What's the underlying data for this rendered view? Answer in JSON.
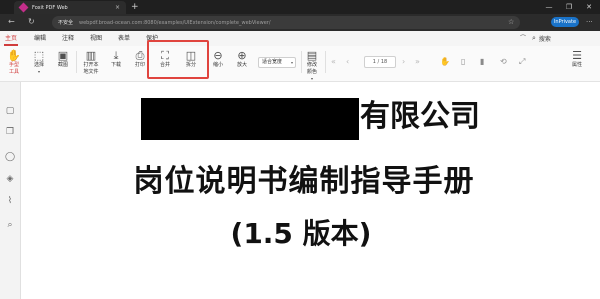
{
  "browser": {
    "tab_title": "Foxit PDF Web",
    "tab_close": "×",
    "new_tab": "+",
    "window_controls": {
      "minimize": "—",
      "maximize": "❐",
      "close": "✕"
    },
    "nav": {
      "back": "←",
      "reload": "↻"
    },
    "security_label": "不安全",
    "url": "webpdf.broad-ocean.com:8080/examples/UIExtension/complete_webViewer/",
    "favorite_icon": "star-icon",
    "inprivate_label": "InPrivate",
    "more": "···"
  },
  "menu": {
    "items": [
      {
        "label": "主页",
        "active": true
      },
      {
        "label": "编辑"
      },
      {
        "label": "注释"
      },
      {
        "label": "视图"
      },
      {
        "label": "表单"
      },
      {
        "label": "保护"
      }
    ],
    "right_symbol": "⌒",
    "search_label": "搜索",
    "accent_color": "#d03c3c"
  },
  "toolbar": {
    "hand_tool": {
      "line1": "手型",
      "line2": "工具"
    },
    "select": {
      "label": "选择"
    },
    "screenshot": {
      "label": "截图"
    },
    "open_local": {
      "line1": "打开本",
      "line2": "地文件"
    },
    "download": {
      "label": "下载"
    },
    "print": {
      "label": "打印"
    },
    "merge": {
      "label": "合并"
    },
    "split": {
      "label": "拆分"
    },
    "zoom_out": {
      "label": "缩小"
    },
    "zoom_in": {
      "label": "放大"
    },
    "zoom_select": {
      "value": "适合宽度"
    },
    "page_input": {
      "value": "1 / 18"
    },
    "modify_color": {
      "line1": "修改",
      "line2": "颜色"
    },
    "properties": {
      "label": "属性"
    },
    "highlight_color": "#e0443e"
  },
  "sidepanel": {
    "icons": [
      "bookmark-panel-icon",
      "pages-panel-icon",
      "comments-panel-icon",
      "layers-panel-icon",
      "attachments-panel-icon",
      "search-panel-icon"
    ]
  },
  "document": {
    "title_line1": "有限公司",
    "title_line2": "岗位说明书编制指导手册",
    "title_line3": "(1.5 版本)"
  }
}
